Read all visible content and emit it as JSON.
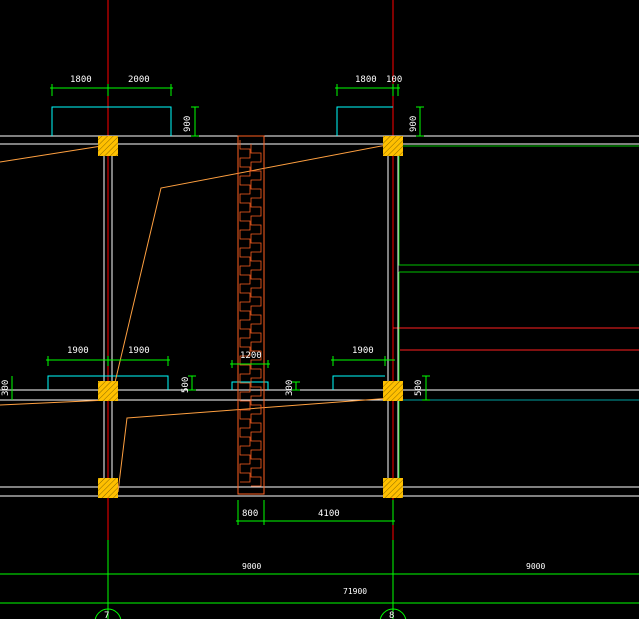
{
  "drawing": {
    "background": "#000000",
    "colors": {
      "axis": "#ff0000",
      "wall": "#ffffff",
      "column": "#ffc000",
      "column_hatch": "#8a6a00",
      "dimension": "#00ff00",
      "window": "#00ffff",
      "orange_line": "#ffa040",
      "stair_hatch": "#ff6020",
      "green_room": "#00c000",
      "red_line": "#ff2020",
      "teal_line": "#00a0a0"
    }
  },
  "dimensions": {
    "top_left_a": "1800",
    "top_left_b": "2000",
    "top_left_h": "900",
    "top_right_a": "1800",
    "top_right_b": "100",
    "top_right_h": "900",
    "mid_left_a": "1900",
    "mid_left_b": "1900",
    "mid_left_h": "500",
    "mid_far_left_h": "300",
    "mid_center_w": "1200",
    "mid_center_h": "300",
    "mid_right_a": "1900",
    "mid_right_h": "500",
    "bottom_a": "800",
    "bottom_b": "4100",
    "span_left": "9000",
    "span_right": "9000",
    "span_total": "71900"
  },
  "axes": {
    "left_label": "7",
    "right_label": "8"
  }
}
